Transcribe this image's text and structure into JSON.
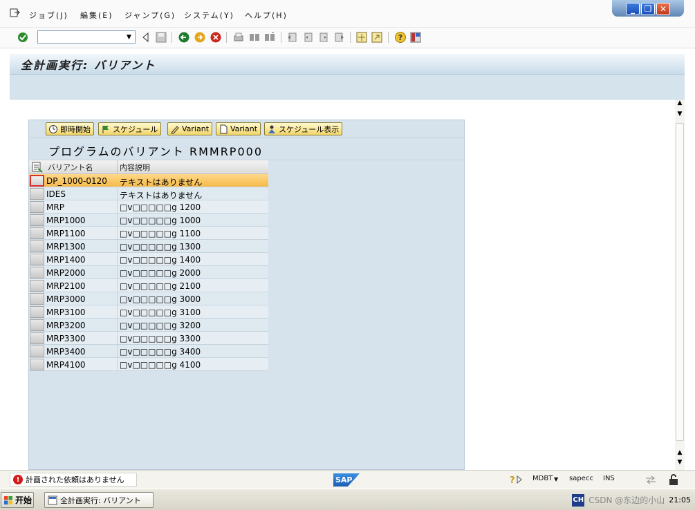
{
  "menubar": {
    "items": [
      {
        "label": "ジョブ(J)"
      },
      {
        "label": "編集(E)"
      },
      {
        "label": "ジャンプ(G)"
      },
      {
        "label": "システム(Y)"
      },
      {
        "label": "ヘルプ(H)"
      }
    ]
  },
  "window_controls": {
    "minimize": "_",
    "restore": "❐",
    "close": "✕"
  },
  "toolbar": {
    "command_field_value": ""
  },
  "titlebar": {
    "title": "全計画実行: バリアント"
  },
  "app_toolbar": {
    "buttons": [
      {
        "label": "即時開始",
        "icon": "clock-execute-icon"
      },
      {
        "label": "スケジュール",
        "icon": "flag-icon"
      },
      {
        "label": "Variant",
        "icon": "pencil-icon"
      },
      {
        "label": "Variant",
        "icon": "new-document-icon"
      },
      {
        "label": "スケジュール表示",
        "icon": "person-schedule-icon"
      }
    ]
  },
  "section": {
    "title": "プログラムのバリアント RMMRP000"
  },
  "table": {
    "columns": [
      "バリアント名",
      "内容説明"
    ],
    "rows": [
      {
        "name": "DP_1000-0120",
        "desc": "テキストはありません",
        "selected": true
      },
      {
        "name": "IDES",
        "desc": "テキストはありません",
        "selected": false
      },
      {
        "name": "MRP",
        "desc": "□v□□□□□g 1200",
        "selected": false
      },
      {
        "name": "MRP1000",
        "desc": "□v□□□□□g 1000",
        "selected": false
      },
      {
        "name": "MRP1100",
        "desc": "□v□□□□□g 1100",
        "selected": false
      },
      {
        "name": "MRP1300",
        "desc": "□v□□□□□g 1300",
        "selected": false
      },
      {
        "name": "MRP1400",
        "desc": "□v□□□□□g 1400",
        "selected": false
      },
      {
        "name": "MRP2000",
        "desc": "□v□□□□□g 2000",
        "selected": false
      },
      {
        "name": "MRP2100",
        "desc": "□v□□□□□g 2100",
        "selected": false
      },
      {
        "name": "MRP3000",
        "desc": "□v□□□□□g 3000",
        "selected": false
      },
      {
        "name": "MRP3100",
        "desc": "□v□□□□□g 3100",
        "selected": false
      },
      {
        "name": "MRP3200",
        "desc": "□v□□□□□g 3200",
        "selected": false
      },
      {
        "name": "MRP3300",
        "desc": "□v□□□□□g 3300",
        "selected": false
      },
      {
        "name": "MRP3400",
        "desc": "□v□□□□□g 3400",
        "selected": false
      },
      {
        "name": "MRP4100",
        "desc": "□v□□□□□g 4100",
        "selected": false
      }
    ]
  },
  "statusbar": {
    "message": "計画された依頼はありません",
    "logo": "SAP",
    "system": "MDBT",
    "server": "sapecc",
    "mode": "INS"
  },
  "taskbar": {
    "start_label": "开始",
    "task_label": "全計画実行: バリアント",
    "ime": "CH",
    "watermark": "CSDN @东边的小山",
    "clock": "21:05"
  }
}
